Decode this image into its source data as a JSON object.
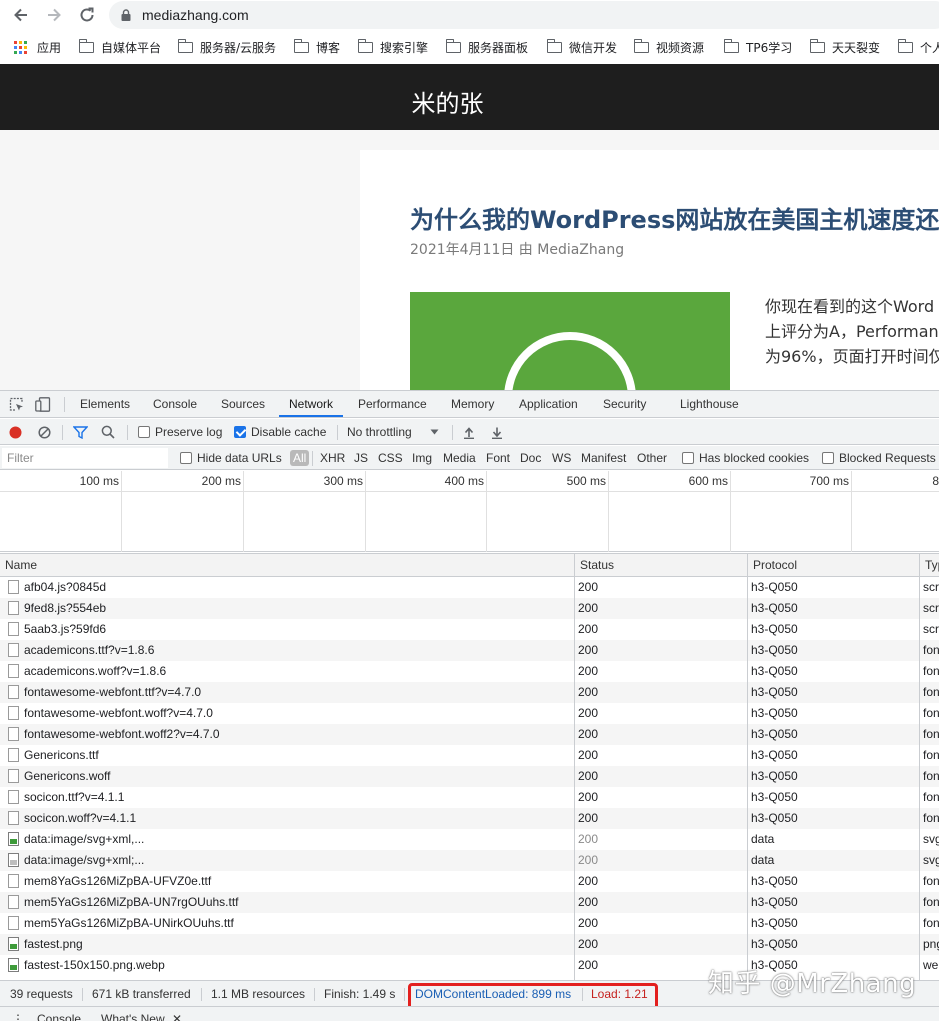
{
  "browser": {
    "url": "mediazhang.com",
    "bookmarks": [
      "应用",
      "自媒体平台",
      "服务器/云服务",
      "博客",
      "搜索引擎",
      "服务器面板",
      "微信开发",
      "视频资源",
      "TP6学习",
      "天天裂变",
      "个人"
    ]
  },
  "site": {
    "title": "米的张",
    "article": {
      "title": "为什么我的WordPress网站放在美国主机速度还",
      "meta": "2021年4月11日 由 MediaZhang",
      "excerpt": [
        "你现在看到的这个Word",
        "上评分为A，Performan",
        "为96%，页面打开时间仅"
      ]
    }
  },
  "devtools": {
    "tabs": [
      "Elements",
      "Console",
      "Sources",
      "Network",
      "Performance",
      "Memory",
      "Application",
      "Security",
      "Lighthouse"
    ],
    "active_tab": "Network",
    "toolbar": {
      "preserve_log": "Preserve log",
      "disable_cache": "Disable cache",
      "throttling": "No throttling"
    },
    "filter": {
      "placeholder": "Filter",
      "hide_data_urls": "Hide data URLs",
      "types": [
        "All",
        "XHR",
        "JS",
        "CSS",
        "Img",
        "Media",
        "Font",
        "Doc",
        "WS",
        "Manifest",
        "Other"
      ],
      "has_blocked_cookies": "Has blocked cookies",
      "blocked_requests": "Blocked Requests"
    },
    "timeline": [
      "100 ms",
      "200 ms",
      "300 ms",
      "400 ms",
      "500 ms",
      "600 ms",
      "700 ms",
      "8"
    ],
    "columns": [
      "Name",
      "Status",
      "Protocol",
      "Typ"
    ],
    "requests": [
      {
        "name": "afb04.js?0845d",
        "status": "200",
        "protocol": "h3-Q050",
        "type": "scr",
        "icon": "file"
      },
      {
        "name": "9fed8.js?554eb",
        "status": "200",
        "protocol": "h3-Q050",
        "type": "scr",
        "icon": "file"
      },
      {
        "name": "5aab3.js?59fd6",
        "status": "200",
        "protocol": "h3-Q050",
        "type": "scr",
        "icon": "file"
      },
      {
        "name": "academicons.ttf?v=1.8.6",
        "status": "200",
        "protocol": "h3-Q050",
        "type": "fon",
        "icon": "file"
      },
      {
        "name": "academicons.woff?v=1.8.6",
        "status": "200",
        "protocol": "h3-Q050",
        "type": "fon",
        "icon": "file"
      },
      {
        "name": "fontawesome-webfont.ttf?v=4.7.0",
        "status": "200",
        "protocol": "h3-Q050",
        "type": "fon",
        "icon": "file"
      },
      {
        "name": "fontawesome-webfont.woff?v=4.7.0",
        "status": "200",
        "protocol": "h3-Q050",
        "type": "fon",
        "icon": "file"
      },
      {
        "name": "fontawesome-webfont.woff2?v=4.7.0",
        "status": "200",
        "protocol": "h3-Q050",
        "type": "fon",
        "icon": "file"
      },
      {
        "name": "Genericons.ttf",
        "status": "200",
        "protocol": "h3-Q050",
        "type": "fon",
        "icon": "file"
      },
      {
        "name": "Genericons.woff",
        "status": "200",
        "protocol": "h3-Q050",
        "type": "fon",
        "icon": "file"
      },
      {
        "name": "socicon.ttf?v=4.1.1",
        "status": "200",
        "protocol": "h3-Q050",
        "type": "fon",
        "icon": "file"
      },
      {
        "name": "socicon.woff?v=4.1.1",
        "status": "200",
        "protocol": "h3-Q050",
        "type": "fon",
        "icon": "file"
      },
      {
        "name": "data:image/svg+xml,...",
        "status": "200",
        "protocol": "data",
        "type": "svg",
        "icon": "image"
      },
      {
        "name": "data:image/svg+xml;...",
        "status": "200",
        "protocol": "data",
        "type": "svg",
        "icon": "image-dim"
      },
      {
        "name": "mem8YaGs126MiZpBA-UFVZ0e.ttf",
        "status": "200",
        "protocol": "h3-Q050",
        "type": "fon",
        "icon": "file"
      },
      {
        "name": "mem5YaGs126MiZpBA-UN7rgOUuhs.ttf",
        "status": "200",
        "protocol": "h3-Q050",
        "type": "fon",
        "icon": "file"
      },
      {
        "name": "mem5YaGs126MiZpBA-UNirkOUuhs.ttf",
        "status": "200",
        "protocol": "h3-Q050",
        "type": "fon",
        "icon": "file"
      },
      {
        "name": "fastest.png",
        "status": "200",
        "protocol": "h3-Q050",
        "type": "png",
        "icon": "image"
      },
      {
        "name": "fastest-150x150.png.webp",
        "status": "200",
        "protocol": "h3-Q050",
        "type": "we",
        "icon": "image"
      }
    ],
    "summary": {
      "requests": "39 requests",
      "transferred": "671 kB transferred",
      "resources": "1.1 MB resources",
      "finish": "Finish: 1.49 s",
      "dom_content_loaded": "DOMContentLoaded: 899 ms",
      "load": "Load: 1.21"
    },
    "drawer_tabs": [
      "Console",
      "What's New"
    ]
  },
  "watermark": "知乎 @MrZhang",
  "colors": {
    "accent": "#1a73e8",
    "header_bg": "#1e1e1e",
    "title_blue": "#2c4d74",
    "thumb_green": "#5aa73d",
    "dcl_blue": "#1a5fb4",
    "load_red": "#c5221f",
    "highlight_red": "#e3201e"
  }
}
